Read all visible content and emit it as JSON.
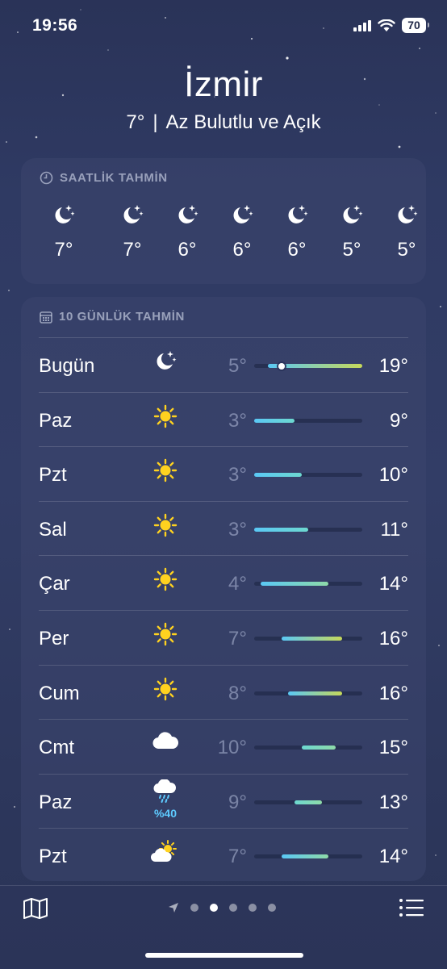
{
  "status_bar": {
    "time": "19:56",
    "battery": "70"
  },
  "location": {
    "city": "İzmir",
    "current_temp": "7°",
    "separator": "|",
    "condition": "Az Bulutlu ve Açık"
  },
  "hourly": {
    "title": "SAATLİK TAHMİN",
    "items": [
      {
        "icon": "moon-stars-icon",
        "temp": "7°"
      },
      {
        "icon": "moon-stars-icon",
        "temp": "7°"
      },
      {
        "icon": "moon-stars-icon",
        "temp": "6°"
      },
      {
        "icon": "moon-stars-icon",
        "temp": "6°"
      },
      {
        "icon": "moon-stars-icon",
        "temp": "6°"
      },
      {
        "icon": "moon-stars-icon",
        "temp": "5°"
      },
      {
        "icon": "moon-stars-icon",
        "temp": "5°"
      }
    ]
  },
  "daily": {
    "title": "10 GÜNLÜK TAHMİN",
    "range_min": 3,
    "range_max": 19,
    "days": [
      {
        "name": "Bugün",
        "icon": "moon-stars-icon",
        "precip": "",
        "low": "5°",
        "high": "19°",
        "low_val": 5,
        "high_val": 19,
        "current_val": 7
      },
      {
        "name": "Paz",
        "icon": "sun-icon",
        "precip": "",
        "low": "3°",
        "high": "9°",
        "low_val": 3,
        "high_val": 9
      },
      {
        "name": "Pzt",
        "icon": "sun-icon",
        "precip": "",
        "low": "3°",
        "high": "10°",
        "low_val": 3,
        "high_val": 10
      },
      {
        "name": "Sal",
        "icon": "sun-icon",
        "precip": "",
        "low": "3°",
        "high": "11°",
        "low_val": 3,
        "high_val": 11
      },
      {
        "name": "Çar",
        "icon": "sun-icon",
        "precip": "",
        "low": "4°",
        "high": "14°",
        "low_val": 4,
        "high_val": 14
      },
      {
        "name": "Per",
        "icon": "sun-icon",
        "precip": "",
        "low": "7°",
        "high": "16°",
        "low_val": 7,
        "high_val": 16
      },
      {
        "name": "Cum",
        "icon": "sun-icon",
        "precip": "",
        "low": "8°",
        "high": "16°",
        "low_val": 8,
        "high_val": 16
      },
      {
        "name": "Cmt",
        "icon": "cloud-icon",
        "precip": "",
        "low": "10°",
        "high": "15°",
        "low_val": 10,
        "high_val": 15
      },
      {
        "name": "Paz",
        "icon": "cloud-rain-icon",
        "precip": "%40",
        "low": "9°",
        "high": "13°",
        "low_val": 9,
        "high_val": 13
      },
      {
        "name": "Pzt",
        "icon": "partly-cloudy-icon",
        "precip": "",
        "low": "7°",
        "high": "14°",
        "low_val": 7,
        "high_val": 14
      }
    ]
  },
  "bottom_bar": {
    "page_count": 5,
    "active_page": 1
  }
}
